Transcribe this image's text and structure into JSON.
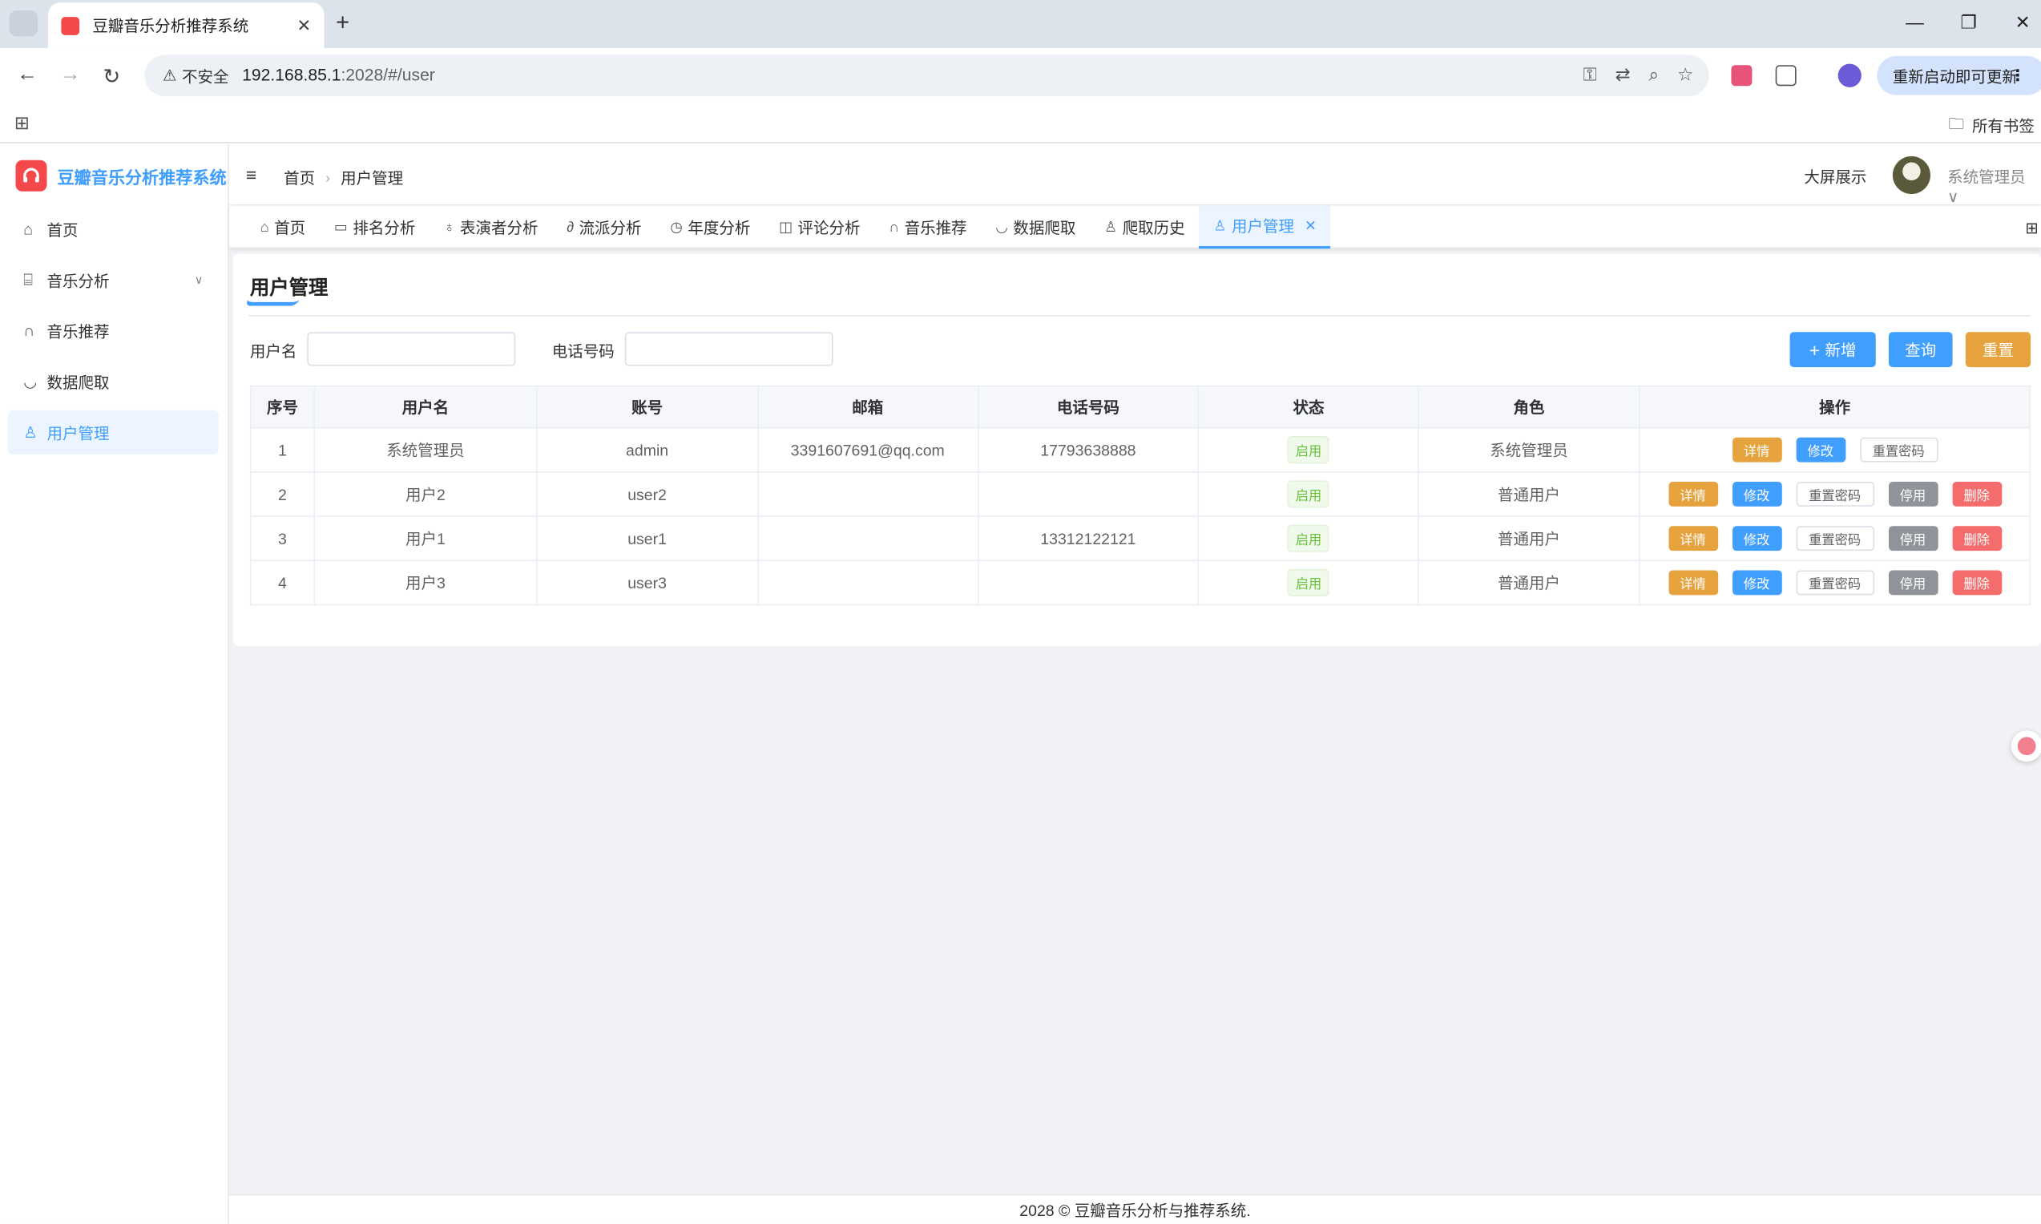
{
  "browser": {
    "tab_title": "豆瓣音乐分析推荐系统",
    "security_label": "不安全",
    "url_host": "192.168.85.1",
    "url_rest": ":2028/#/user",
    "update_label": "重新启动即可更新",
    "bookmarks_label": "所有书签"
  },
  "sidebar": {
    "app_name": "豆瓣音乐分析推荐系统",
    "items": [
      {
        "label": "首页",
        "icon": "home-icon"
      },
      {
        "label": "音乐分析",
        "icon": "chart-icon"
      },
      {
        "label": "音乐推荐",
        "icon": "headphones-icon"
      },
      {
        "label": "数据爬取",
        "icon": "bowl-icon"
      },
      {
        "label": "用户管理",
        "icon": "user-icon"
      }
    ]
  },
  "header": {
    "breadcrumb": [
      "首页",
      "用户管理"
    ],
    "big_screen": "大屏展示",
    "user_name": "系统管理员"
  },
  "tags": [
    {
      "label": "首页",
      "icon": "home-icon"
    },
    {
      "label": "排名分析",
      "icon": "folder-icon"
    },
    {
      "label": "表演者分析",
      "icon": "bulb-icon"
    },
    {
      "label": "流派分析",
      "icon": "paperclip-icon"
    },
    {
      "label": "年度分析",
      "icon": "compass-icon"
    },
    {
      "label": "评论分析",
      "icon": "book-icon"
    },
    {
      "label": "音乐推荐",
      "icon": "headphones-icon"
    },
    {
      "label": "数据爬取",
      "icon": "bowl-icon"
    },
    {
      "label": "爬取历史",
      "icon": "user-icon"
    },
    {
      "label": "用户管理",
      "icon": "user-icon"
    }
  ],
  "page": {
    "title": "用户管理",
    "search": {
      "username_label": "用户名",
      "phone_label": "电话号码"
    },
    "buttons": {
      "add": "新增",
      "query": "查询",
      "reset": "重置"
    }
  },
  "table": {
    "columns": [
      "序号",
      "用户名",
      "账号",
      "邮箱",
      "电话号码",
      "状态",
      "角色",
      "操作"
    ],
    "rows": [
      {
        "no": "1",
        "name": "系统管理员",
        "account": "admin",
        "email": "3391607691@qq.com",
        "phone": "17793638888",
        "status": "启用",
        "role": "系统管理员"
      },
      {
        "no": "2",
        "name": "用户2",
        "account": "user2",
        "email": "",
        "phone": "",
        "status": "启用",
        "role": "普通用户"
      },
      {
        "no": "3",
        "name": "用户1",
        "account": "user1",
        "email": "",
        "phone": "13312122121",
        "status": "启用",
        "role": "普通用户"
      },
      {
        "no": "4",
        "name": "用户3",
        "account": "user3",
        "email": "",
        "phone": "",
        "status": "启用",
        "role": "普通用户"
      }
    ],
    "ops": {
      "detail": "详情",
      "edit": "修改",
      "reset_pwd": "重置密码",
      "disable": "停用",
      "delete": "删除"
    }
  },
  "footer": "2028 © 豆瓣音乐分析与推荐系统.",
  "colors": {
    "primary": "#409eff",
    "warning": "#e6a23c",
    "danger": "#f56c6c",
    "info": "#909399",
    "success": "#67c23a",
    "brand": "#f5484b"
  }
}
